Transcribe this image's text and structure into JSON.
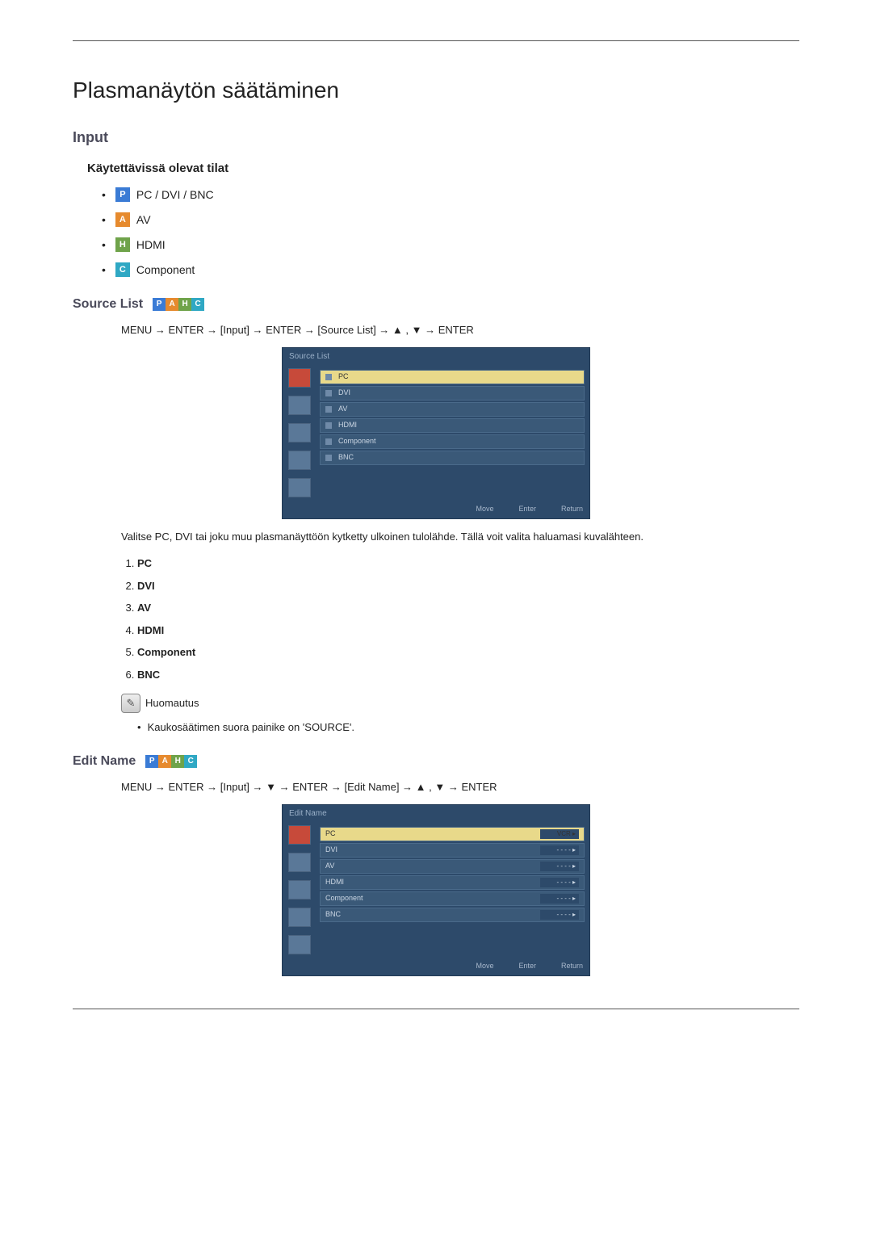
{
  "page": {
    "title": "Plasmanäytön säätäminen",
    "section": "Input",
    "modes_heading": "Käytettävissä olevat tilat"
  },
  "badges": {
    "p": "P",
    "a": "A",
    "h": "H",
    "c": "C"
  },
  "modes": {
    "pc": "PC / DVI / BNC",
    "av": "AV",
    "hdmi": "HDMI",
    "component": "Component"
  },
  "source_list": {
    "heading": "Source List",
    "path": "MENU → ENTER → [Input] → ENTER → [Source List] → ▲ , ▼ → ENTER",
    "osd_title": "Source List",
    "items": [
      "PC",
      "DVI",
      "AV",
      "HDMI",
      "Component",
      "BNC"
    ],
    "footer": {
      "move": "Move",
      "enter": "Enter",
      "return": "Return"
    },
    "desc": "Valitse PC, DVI tai joku muu plasmanäyttöön kytketty ulkoinen tulolähde. Tällä voit valita haluamasi kuvalähteen.",
    "numbered": [
      "PC",
      "DVI",
      "AV",
      "HDMI",
      "Component",
      "BNC"
    ],
    "note_label": "Huomautus",
    "note_item": "Kaukosäätimen suora painike on 'SOURCE'."
  },
  "edit_name": {
    "heading": "Edit Name",
    "path": "MENU → ENTER → [Input] → ▼ → ENTER → [Edit Name] → ▲ , ▼ → ENTER",
    "osd_title": "Edit Name",
    "rows": [
      {
        "label": "PC",
        "value": "VCR ▸"
      },
      {
        "label": "DVI",
        "value": "- - - - ▸"
      },
      {
        "label": "AV",
        "value": "- - - - ▸"
      },
      {
        "label": "HDMI",
        "value": "- - - - ▸"
      },
      {
        "label": "Component",
        "value": "- - - - ▸"
      },
      {
        "label": "BNC",
        "value": "- - - - ▸"
      }
    ],
    "footer": {
      "move": "Move",
      "enter": "Enter",
      "return": "Return"
    }
  }
}
